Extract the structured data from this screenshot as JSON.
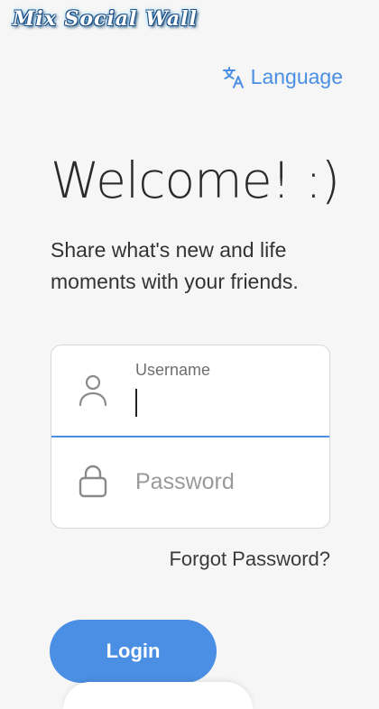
{
  "app": {
    "logo_text": "Mix Social Wall"
  },
  "header": {
    "language_label": "Language",
    "language_icon": "translate-icon"
  },
  "welcome": {
    "title": "Welcome! :)",
    "tagline": "Share what's new and life moments with your friends."
  },
  "form": {
    "username": {
      "label": "Username",
      "value": "",
      "icon": "person-icon"
    },
    "password": {
      "placeholder": "Password",
      "value": "",
      "icon": "lock-icon"
    },
    "forgot_label": "Forgot Password?",
    "login_label": "Login"
  },
  "colors": {
    "accent": "#4a8fe3",
    "background": "#f6f6f6",
    "card": "#ffffff"
  }
}
